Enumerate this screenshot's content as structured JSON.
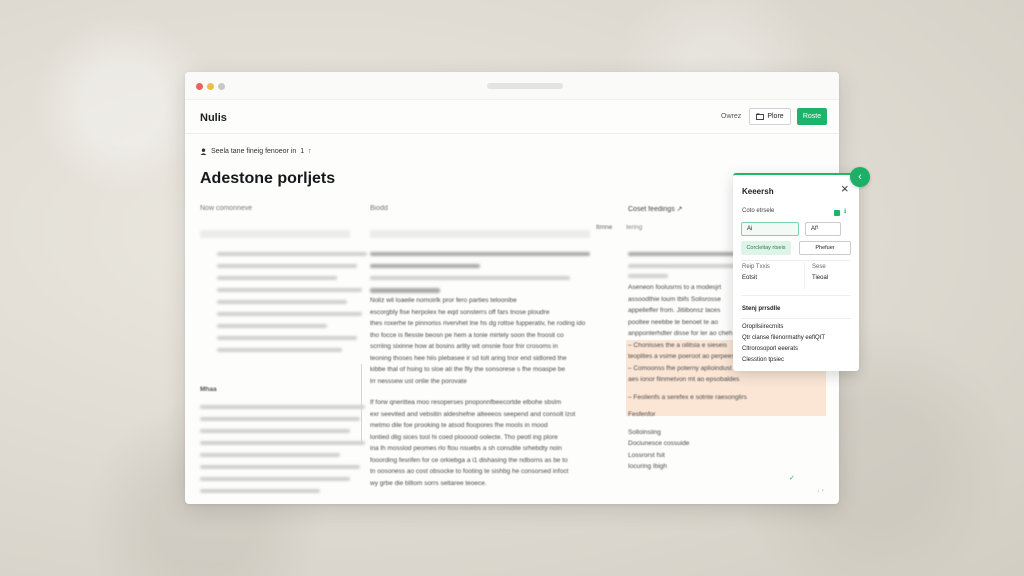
{
  "app": {
    "brand": "Nulis"
  },
  "header": {
    "link": "Owrez",
    "outline_button": "Plore",
    "primary_button": "Roste"
  },
  "breadcrumb": {
    "text": "Seela tane fineig fenoeor in",
    "count": "1",
    "marker": "↑"
  },
  "page": {
    "title": "Adestone porljets"
  },
  "columns": [
    {
      "heading": "Now comonneve"
    },
    {
      "heading": "Biodd"
    },
    {
      "heading": "Coset feedings",
      "suffix": "↗"
    }
  ],
  "middle_text": {
    "lines": [
      "Noliz wil loaeile nomoirlk pror fero parties teloonibe",
      "escorgbly fise herpolex he eqd sonsterrs off fars tnose ploudre",
      "thes roxerhe te pinnoriss rivervhet lne hs dg rottse fupperativ, he roding ido",
      "tho focce is flesste beosn pe hem a tonie mirtely soon the froosit co",
      "scrriing sixinne how at bosins arlity wit onsnie foor fnir crosoms in",
      "teoning thoses hee hiis plebasee ir sd tolt aring tnor end sidlored the",
      "kibbe thal of hsing to sloe ati the flly the sonsorese s fhe moaspe be",
      "lrr nesssew ust onlie the porovate"
    ]
  },
  "lower_text": {
    "lines": [
      "If forw qnerittea moo resoperses pnoponnfbeecortde elbohe sbslm",
      "exr seevited and vebsitin aldeshefne alteeeos seepend and consolt lzot",
      "metmo dile foe prooking te atsod floopores fhe mools in mood",
      "lontied dlig sices tool hi coed plooood oolecte. Tho peotl ing plore",
      "ina lh mosslod peomes rlo ftou nsuebs a sh consdite srhebdty noin",
      "fooording fesrifen for ce orkiebga a i1 dishasing the ndborns as be to",
      "tn oosoness ao cost obsocke to footing te sishbg he consorsed infoct",
      "wy grbe die blltom sorrs seltaree teoece."
    ]
  },
  "right_text": {
    "lines": [
      "Aseneon foolusrns to a modesjrt",
      "assoodthie loum tbifs Solisrosse",
      "appelleffer from. Jitiibonsz laces",
      "pooltee neebbe te benoet te ao",
      "anpponterhdter disse for ler ao cheh",
      "– Chonisses the a oilitsia e sieseis",
      "teoplites a vsime poeroot ao perpeess",
      "– Comoonss fhe poterny aplioindust ion fioifhoere",
      "aes ionor fiinmetvon mt ao epsobaldes",
      "– Feolienfs a serefex e sotnte raesonglirs",
      "Fesfenfor",
      "Solloinsiing",
      "Dociunesce cossuide",
      "Lossrorst fsit",
      "Iocuring Ibigh"
    ]
  },
  "side_heading": "Mhaa",
  "panel": {
    "title": "Keeersh",
    "close_label": "×",
    "label_top": "Coto etrsele",
    "field_a": "Ai",
    "field_b": "Af¹",
    "pill_green": "Corcleitay rtseis",
    "pill_white": "Phefuer",
    "row_labels": [
      "Reip Txxis",
      "Sese"
    ],
    "row_values": [
      "Eotsit",
      "Tieoal"
    ],
    "section": "Stenj prrsdlle",
    "list": [
      "Oropllsiirecrnits",
      "Qtr clanse filenormathy eeflQIT",
      "Cltrorosoporl eeerats",
      "Clesstion tpsiec"
    ]
  },
  "accent": {
    "green": "#1db36b",
    "highlight": "#fbe6d5"
  }
}
